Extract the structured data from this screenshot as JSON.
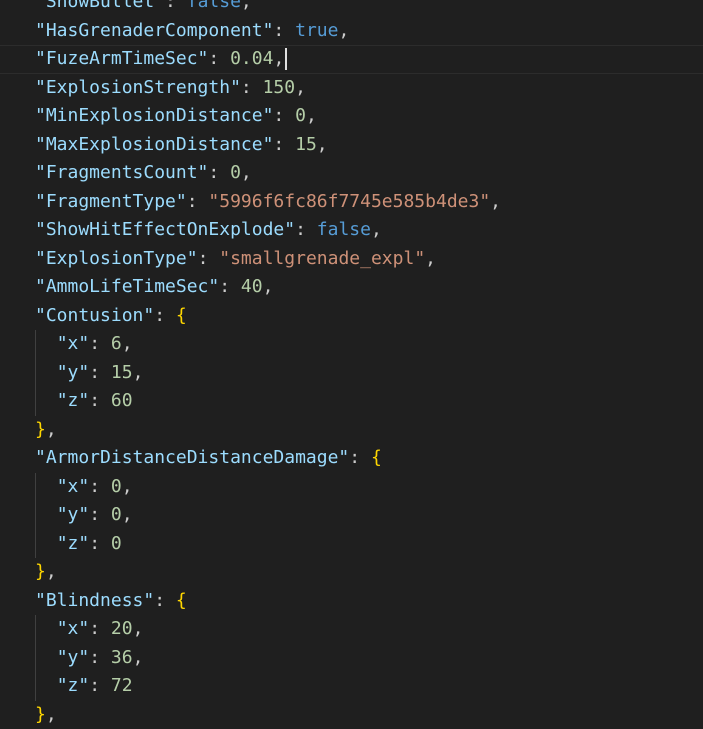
{
  "editor": {
    "lines": [
      {
        "indent": 0,
        "parts": [
          {
            "t": "key",
            "v": "\"ShowBullet\""
          },
          {
            "t": "punct",
            "v": ": "
          },
          {
            "t": "bool",
            "v": "false"
          },
          {
            "t": "punct",
            "v": ","
          }
        ]
      },
      {
        "indent": 0,
        "parts": [
          {
            "t": "key",
            "v": "\"HasGrenaderComponent\""
          },
          {
            "t": "punct",
            "v": ": "
          },
          {
            "t": "bool",
            "v": "true"
          },
          {
            "t": "punct",
            "v": ","
          }
        ]
      },
      {
        "indent": 0,
        "current": true,
        "cursor": true,
        "parts": [
          {
            "t": "key",
            "v": "\"FuzeArmTimeSec\""
          },
          {
            "t": "punct",
            "v": ": "
          },
          {
            "t": "num",
            "v": "0.04"
          },
          {
            "t": "punct",
            "v": ","
          }
        ]
      },
      {
        "indent": 0,
        "parts": [
          {
            "t": "key",
            "v": "\"ExplosionStrength\""
          },
          {
            "t": "punct",
            "v": ": "
          },
          {
            "t": "num",
            "v": "150"
          },
          {
            "t": "punct",
            "v": ","
          }
        ]
      },
      {
        "indent": 0,
        "parts": [
          {
            "t": "key",
            "v": "\"MinExplosionDistance\""
          },
          {
            "t": "punct",
            "v": ": "
          },
          {
            "t": "num",
            "v": "0"
          },
          {
            "t": "punct",
            "v": ","
          }
        ]
      },
      {
        "indent": 0,
        "parts": [
          {
            "t": "key",
            "v": "\"MaxExplosionDistance\""
          },
          {
            "t": "punct",
            "v": ": "
          },
          {
            "t": "num",
            "v": "15"
          },
          {
            "t": "punct",
            "v": ","
          }
        ]
      },
      {
        "indent": 0,
        "parts": [
          {
            "t": "key",
            "v": "\"FragmentsCount\""
          },
          {
            "t": "punct",
            "v": ": "
          },
          {
            "t": "num",
            "v": "0"
          },
          {
            "t": "punct",
            "v": ","
          }
        ]
      },
      {
        "indent": 0,
        "parts": [
          {
            "t": "key",
            "v": "\"FragmentType\""
          },
          {
            "t": "punct",
            "v": ": "
          },
          {
            "t": "str",
            "v": "\"5996f6fc86f7745e585b4de3\""
          },
          {
            "t": "punct",
            "v": ","
          }
        ]
      },
      {
        "indent": 0,
        "parts": [
          {
            "t": "key",
            "v": "\"ShowHitEffectOnExplode\""
          },
          {
            "t": "punct",
            "v": ": "
          },
          {
            "t": "bool",
            "v": "false"
          },
          {
            "t": "punct",
            "v": ","
          }
        ]
      },
      {
        "indent": 0,
        "parts": [
          {
            "t": "key",
            "v": "\"ExplosionType\""
          },
          {
            "t": "punct",
            "v": ": "
          },
          {
            "t": "str",
            "v": "\"smallgrenade_expl\""
          },
          {
            "t": "punct",
            "v": ","
          }
        ]
      },
      {
        "indent": 0,
        "parts": [
          {
            "t": "key",
            "v": "\"AmmoLifeTimeSec\""
          },
          {
            "t": "punct",
            "v": ": "
          },
          {
            "t": "num",
            "v": "40"
          },
          {
            "t": "punct",
            "v": ","
          }
        ]
      },
      {
        "indent": 0,
        "parts": [
          {
            "t": "key",
            "v": "\"Contusion\""
          },
          {
            "t": "punct",
            "v": ": "
          },
          {
            "t": "brace",
            "v": "{"
          }
        ]
      },
      {
        "indent": 1,
        "parts": [
          {
            "t": "key",
            "v": "\"x\""
          },
          {
            "t": "punct",
            "v": ": "
          },
          {
            "t": "num",
            "v": "6"
          },
          {
            "t": "punct",
            "v": ","
          }
        ]
      },
      {
        "indent": 1,
        "parts": [
          {
            "t": "key",
            "v": "\"y\""
          },
          {
            "t": "punct",
            "v": ": "
          },
          {
            "t": "num",
            "v": "15"
          },
          {
            "t": "punct",
            "v": ","
          }
        ]
      },
      {
        "indent": 1,
        "parts": [
          {
            "t": "key",
            "v": "\"z\""
          },
          {
            "t": "punct",
            "v": ": "
          },
          {
            "t": "num",
            "v": "60"
          }
        ]
      },
      {
        "indent": 0,
        "parts": [
          {
            "t": "brace",
            "v": "}"
          },
          {
            "t": "punct",
            "v": ","
          }
        ]
      },
      {
        "indent": 0,
        "parts": [
          {
            "t": "key",
            "v": "\"ArmorDistanceDistanceDamage\""
          },
          {
            "t": "punct",
            "v": ": "
          },
          {
            "t": "brace",
            "v": "{"
          }
        ]
      },
      {
        "indent": 1,
        "parts": [
          {
            "t": "key",
            "v": "\"x\""
          },
          {
            "t": "punct",
            "v": ": "
          },
          {
            "t": "num",
            "v": "0"
          },
          {
            "t": "punct",
            "v": ","
          }
        ]
      },
      {
        "indent": 1,
        "parts": [
          {
            "t": "key",
            "v": "\"y\""
          },
          {
            "t": "punct",
            "v": ": "
          },
          {
            "t": "num",
            "v": "0"
          },
          {
            "t": "punct",
            "v": ","
          }
        ]
      },
      {
        "indent": 1,
        "parts": [
          {
            "t": "key",
            "v": "\"z\""
          },
          {
            "t": "punct",
            "v": ": "
          },
          {
            "t": "num",
            "v": "0"
          }
        ]
      },
      {
        "indent": 0,
        "parts": [
          {
            "t": "brace",
            "v": "}"
          },
          {
            "t": "punct",
            "v": ","
          }
        ]
      },
      {
        "indent": 0,
        "parts": [
          {
            "t": "key",
            "v": "\"Blindness\""
          },
          {
            "t": "punct",
            "v": ": "
          },
          {
            "t": "brace",
            "v": "{"
          }
        ]
      },
      {
        "indent": 1,
        "parts": [
          {
            "t": "key",
            "v": "\"x\""
          },
          {
            "t": "punct",
            "v": ": "
          },
          {
            "t": "num",
            "v": "20"
          },
          {
            "t": "punct",
            "v": ","
          }
        ]
      },
      {
        "indent": 1,
        "parts": [
          {
            "t": "key",
            "v": "\"y\""
          },
          {
            "t": "punct",
            "v": ": "
          },
          {
            "t": "num",
            "v": "36"
          },
          {
            "t": "punct",
            "v": ","
          }
        ]
      },
      {
        "indent": 1,
        "parts": [
          {
            "t": "key",
            "v": "\"z\""
          },
          {
            "t": "punct",
            "v": ": "
          },
          {
            "t": "num",
            "v": "72"
          }
        ]
      },
      {
        "indent": 0,
        "parts": [
          {
            "t": "brace",
            "v": "}"
          },
          {
            "t": "punct",
            "v": ","
          }
        ]
      }
    ]
  },
  "colors": {
    "background": "#1f1f1f",
    "key": "#9cdcfe",
    "string": "#ce9178",
    "number": "#b5cea8",
    "boolean": "#569cd6",
    "brace": "#ffd700",
    "punctuation": "#cccccc"
  }
}
